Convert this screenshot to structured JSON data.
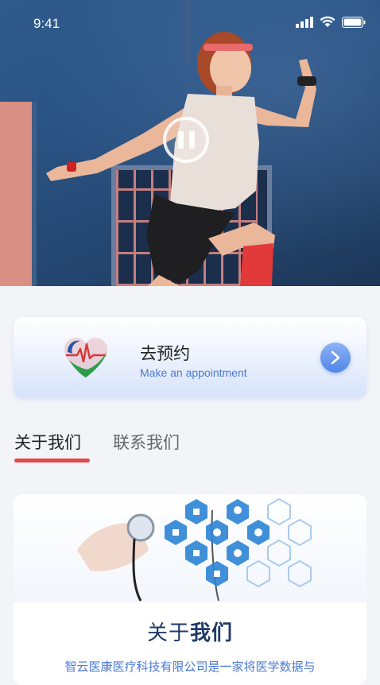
{
  "status_bar": {
    "time": "9:41"
  },
  "video": {
    "pause_icon": "pause-icon"
  },
  "appointment": {
    "title": "去预约",
    "subtitle": "Make an appointment",
    "arrow_icon": "chevron-right-icon"
  },
  "tabs": [
    {
      "label": "关于我们",
      "active": true
    },
    {
      "label": "联系我们",
      "active": false
    }
  ],
  "about": {
    "heading_prefix": "关于",
    "heading_bold": "我们",
    "body": "智云医康医疗科技有限公司是一家将医学数据与"
  },
  "colors": {
    "accent_blue": "#4f86e8",
    "tab_underline": "#e04a4a",
    "heading": "#1f3a68"
  }
}
